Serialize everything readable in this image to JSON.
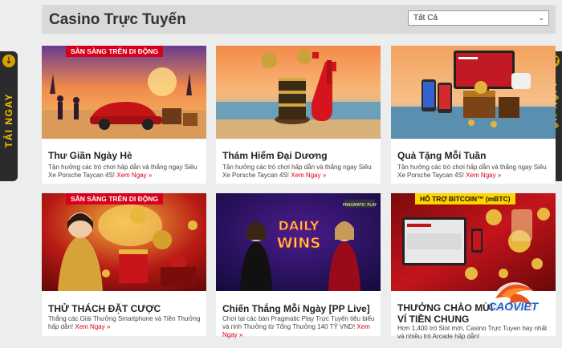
{
  "header": {
    "title": "Casino Trực Tuyến",
    "filter": {
      "selected": "Tất Cả"
    }
  },
  "side_tabs": {
    "left": "TẢI NGAY",
    "right": "LIÊN HỆ"
  },
  "cards": [
    {
      "badge": "SẴN SÀNG TRÊN DI ĐỘNG",
      "title": "Thư Giãn Ngày Hè",
      "desc": "Tận hưởng các trò chơi hấp dẫn và thắng ngay Siêu Xe Porsche Taycan 4S!",
      "link": "Xem Ngay »"
    },
    {
      "badge": "",
      "title": "Thám Hiểm Đại Dương",
      "desc": "Tận hưởng các trò chơi hấp dẫn và thắng ngay Siêu Xe Porsche Taycan 4S!",
      "link": "Xem Ngay »"
    },
    {
      "badge": "",
      "title": "Quà Tặng Mỗi Tuần",
      "desc": "Tận hưởng các trò chơi hấp dẫn và thắng ngay Siêu Xe Porsche Taycan 4S!",
      "link": "Xem Ngay »"
    },
    {
      "badge": "SẴN SÀNG TRÊN DI ĐỘNG",
      "title": "THỬ THÁCH ĐẶT CƯỢC",
      "desc": "Thắng các Giải Thưởng Smartphone và Tiền Thưởng hấp dẫn!",
      "link": "Xem Ngay »"
    },
    {
      "badge": "",
      "title": "Chiến Thắng Mỗi Ngày [PP Live]",
      "desc": "Chơi tại các bàn Pragmatic Play Trực Tuyến tiêu biểu và rinh Thưởng từ Tổng Thưởng 140 TỶ VND!",
      "link": "Xem Ngay »",
      "banner": "DAILY WINS",
      "provider": "PRAGMATIC PLAY"
    },
    {
      "badge": "HỖ TRỢ BITCOIN™ (mBTC)",
      "title": "THƯỞNG CHÀO MỪNG 100%",
      "title2": "VÍ TIỀN CHUNG",
      "desc": "Hơn 1,400 trò Slot mới, Casino Trực Tuyến hay nhất và nhiều trò Arcade hấp dẫn!",
      "link": ""
    }
  ],
  "logo": {
    "text": "CAOVIET"
  }
}
